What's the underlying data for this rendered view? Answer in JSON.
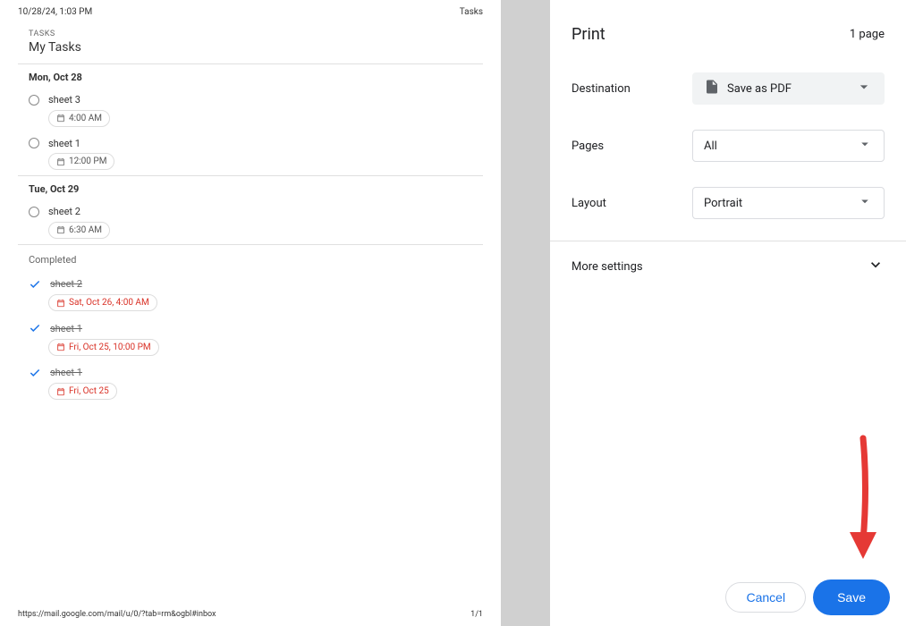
{
  "preview": {
    "header_date": "10/28/24, 1:03 PM",
    "header_title": "Tasks",
    "tasks_label": "TASKS",
    "tasks_title": "My Tasks",
    "date1": "Mon, Oct 28",
    "task1": "sheet 3",
    "task1_time": "4:00 AM",
    "task2": "sheet 1",
    "task2_time": "12:00 PM",
    "date2": "Tue, Oct 29",
    "task3": "sheet 2",
    "task3_time": "6:30 AM",
    "completed_label": "Completed",
    "comp1": "sheet 2",
    "comp1_time": "Sat, Oct 26, 4:00 AM",
    "comp2": "sheet 1",
    "comp2_time": "Fri, Oct 25, 10:00 PM",
    "comp3": "sheet 1",
    "comp3_time": "Fri, Oct 25",
    "footer_url": "https://mail.google.com/mail/u/0/?tab=rm&ogbl#inbox",
    "footer_page": "1/1"
  },
  "print": {
    "title": "Print",
    "page_count": "1 page",
    "destination_label": "Destination",
    "destination_value": "Save as PDF",
    "pages_label": "Pages",
    "pages_value": "All",
    "layout_label": "Layout",
    "layout_value": "Portrait",
    "more_settings": "More settings",
    "cancel": "Cancel",
    "save": "Save"
  }
}
